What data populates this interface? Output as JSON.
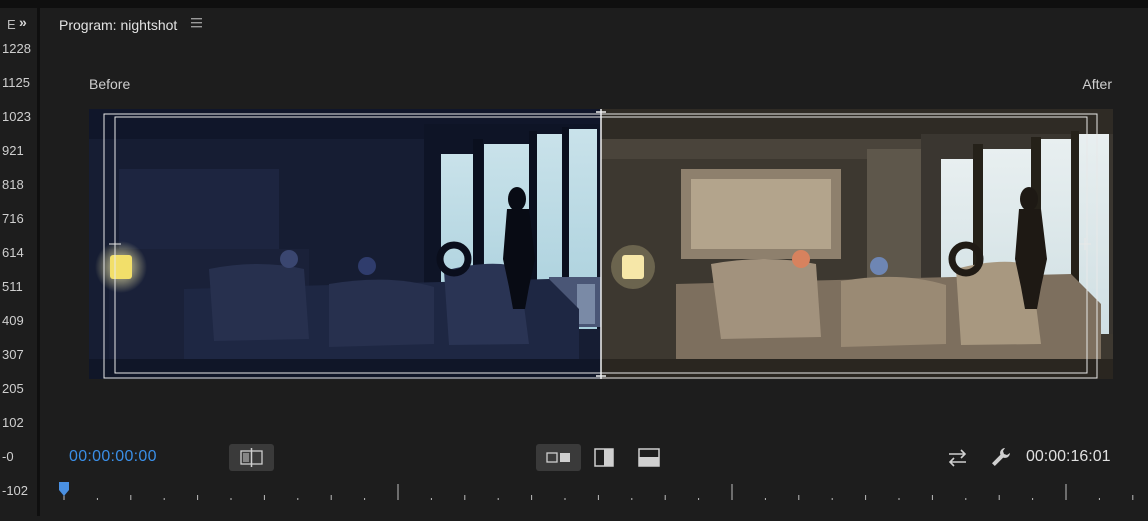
{
  "left_strip": {
    "header_label": "E",
    "expand_glyph": "»",
    "scale": [
      "1228",
      "1125",
      "1023",
      "921",
      "818",
      "716",
      "614",
      "511",
      "409",
      "307",
      "205",
      "102",
      "-0",
      "-102"
    ]
  },
  "panel": {
    "title": "Program: nightshot",
    "menu_icon": "hamburger-menu-icon"
  },
  "viewer": {
    "before_label": "Before",
    "after_label": "After"
  },
  "controls": {
    "current_timecode": "00:00:00:00",
    "duration_timecode": "00:00:16:01",
    "accent_color": "#3a8ee6",
    "icons": [
      "swap-view-icon",
      "side-by-side-icon",
      "vertical-split-icon",
      "horizontal-split-icon",
      "swap-sides-icon",
      "wrench-settings-icon"
    ]
  },
  "ruler": {
    "playhead_color": "#4a90e2"
  }
}
